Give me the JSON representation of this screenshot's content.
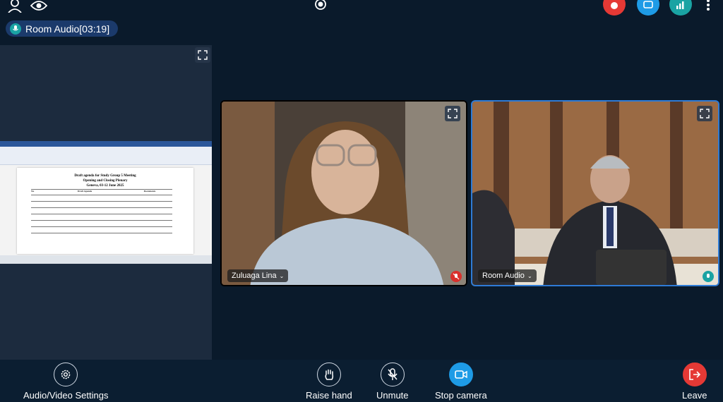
{
  "room_audio_pill": {
    "label": "Room Audio[03:19]"
  },
  "shared_document": {
    "title_line1": "Draft agenda for Study Group 5 Meeting",
    "title_line2": "Opening and Closing Plenary",
    "title_line3": "Geneva, 03-12 June 2025",
    "col_no": "No",
    "col_agenda": "Draft Agenda",
    "col_docs": "Documents"
  },
  "participants": [
    {
      "name": "Zuluaga Lina",
      "status_color": "#d9302c"
    },
    {
      "name": "Room Audio",
      "status_color": "#1aa3a3"
    }
  ],
  "controls": {
    "av_settings": "Audio/Video Settings",
    "raise_hand": "Raise hand",
    "unmute": "Unmute",
    "stop_camera": "Stop camera",
    "leave": "Leave"
  },
  "colors": {
    "background": "#0a1a2b",
    "accent_blue": "#1e9be6",
    "leave_red": "#e53935",
    "teal": "#1aa3a3"
  }
}
